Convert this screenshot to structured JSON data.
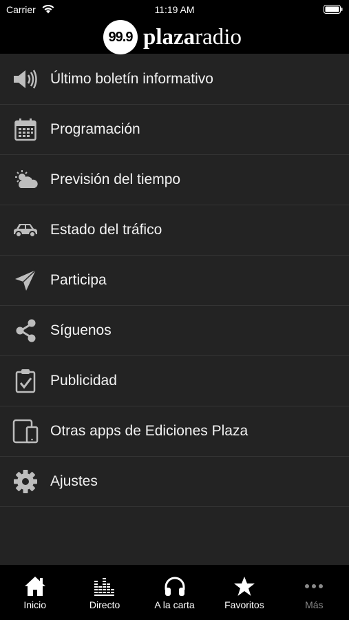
{
  "status_bar": {
    "carrier": "Carrier",
    "time": "11:19 AM"
  },
  "header": {
    "logo_number": "99.9",
    "logo_bold": "plaza",
    "logo_light": "radio"
  },
  "menu": [
    {
      "label": "Último boletín informativo",
      "icon": "speaker-icon"
    },
    {
      "label": "Programación",
      "icon": "calendar-icon"
    },
    {
      "label": "Previsión del tiempo",
      "icon": "weather-icon"
    },
    {
      "label": "Estado del tráfico",
      "icon": "car-icon"
    },
    {
      "label": "Participa",
      "icon": "paper-plane-icon"
    },
    {
      "label": "Síguenos",
      "icon": "share-icon"
    },
    {
      "label": "Publicidad",
      "icon": "clipboard-icon"
    },
    {
      "label": "Otras apps de Ediciones Plaza",
      "icon": "devices-icon"
    },
    {
      "label": "Ajustes",
      "icon": "gear-icon"
    }
  ],
  "tabs": [
    {
      "label": "Inicio",
      "icon": "home-icon"
    },
    {
      "label": "Directo",
      "icon": "equalizer-icon"
    },
    {
      "label": "A la carta",
      "icon": "headphones-icon"
    },
    {
      "label": "Favoritos",
      "icon": "star-icon"
    },
    {
      "label": "Más",
      "icon": "more-icon",
      "dimmed": true
    }
  ],
  "colors": {
    "background": "#232323",
    "bars": "#000000",
    "divider": "#343434",
    "icon": "#bdbdbd"
  }
}
